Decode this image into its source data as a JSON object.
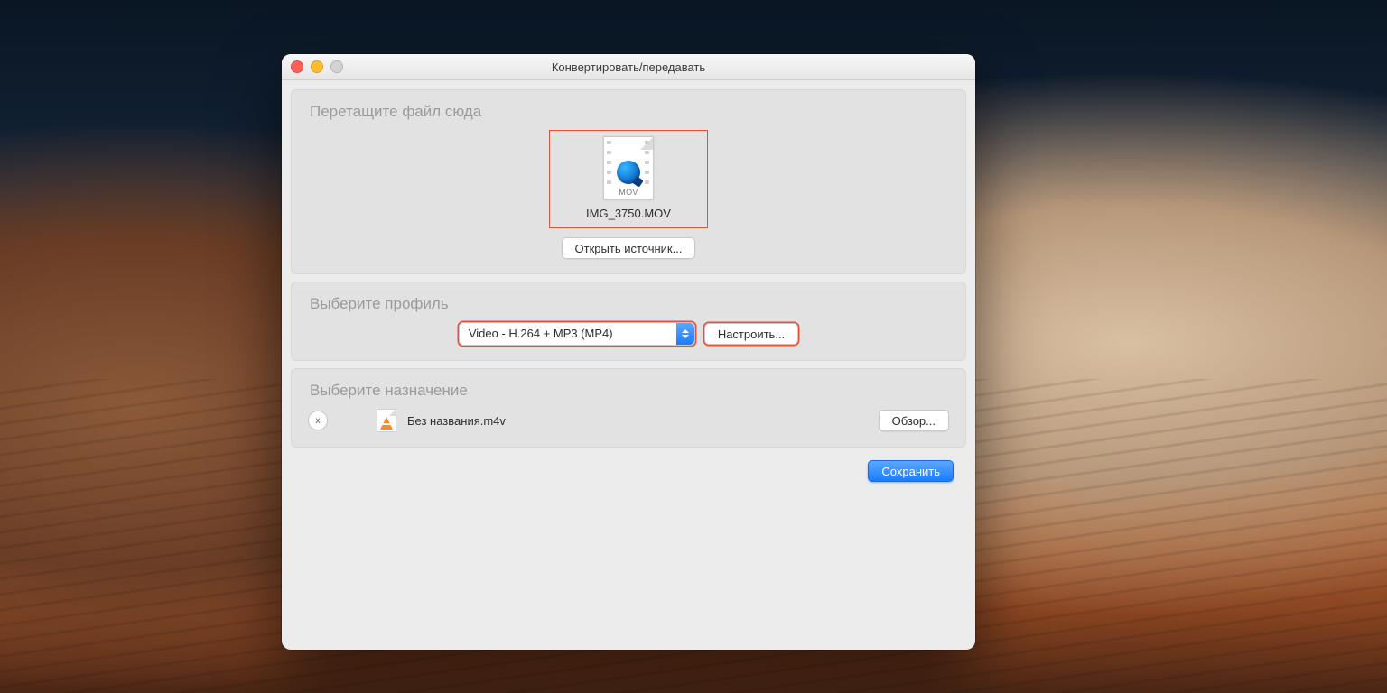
{
  "window": {
    "title": "Конвертировать/передавать"
  },
  "drop": {
    "title": "Перетащите файл сюда",
    "file_name": "IMG_3750.MOV",
    "file_ext": "MOV",
    "open_source_btn": "Открыть источник..."
  },
  "profile": {
    "title": "Выберите профиль",
    "selected": "Video - H.264 + MP3 (MP4)",
    "customize_btn": "Настроить..."
  },
  "dest": {
    "title": "Выберите назначение",
    "remove_char": "x",
    "file_label": "Без названия.m4v",
    "browse_btn": "Обзор..."
  },
  "footer": {
    "save_btn": "Сохранить"
  }
}
